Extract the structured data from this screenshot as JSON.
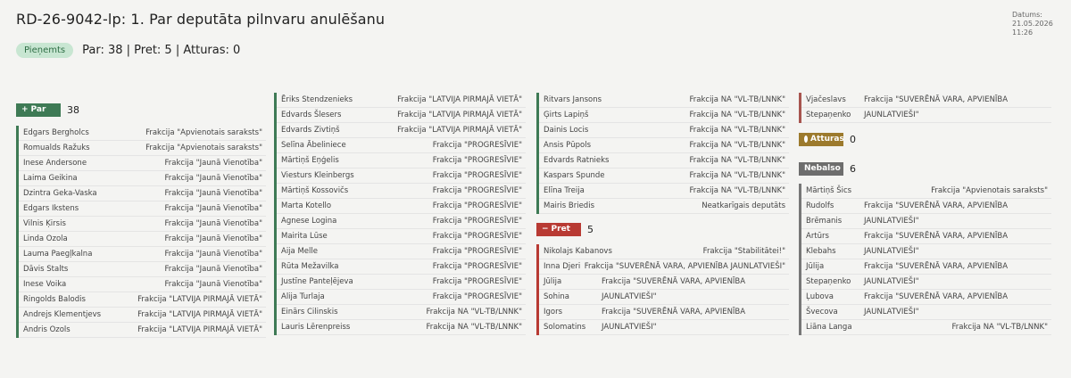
{
  "header": {
    "title": "RD-26-9042-lp: 1. Par deputāta pilnvaru anulēšanu",
    "date_label": "Datums:",
    "date": "21.05.2026",
    "time": "11:26"
  },
  "summary": {
    "status": "Pieņemts",
    "counts": "Par: 38 | Pret: 5 | Atturas: 0"
  },
  "sections": {
    "par": {
      "label": "Par",
      "count": "38"
    },
    "pret": {
      "label": "Pret",
      "count": "5"
    },
    "atturas": {
      "label": "Atturas",
      "count": "0"
    },
    "nebalso": {
      "label": "Nebalso",
      "count": "6"
    }
  },
  "col1": [
    {
      "name": "Edgars Bergholcs",
      "faction": "Frakcija \"Apvienotais saraksts\""
    },
    {
      "name": "Romualds Ražuks",
      "faction": "Frakcija \"Apvienotais saraksts\""
    },
    {
      "name": "Inese Andersone",
      "faction": "Frakcija \"Jaunā Vienotība\""
    },
    {
      "name": "Laima Geikina",
      "faction": "Frakcija \"Jaunā Vienotība\""
    },
    {
      "name": "Dzintra Geka-Vaska",
      "faction": "Frakcija \"Jaunā Vienotība\""
    },
    {
      "name": "Edgars Ikstens",
      "faction": "Frakcija \"Jaunā Vienotība\""
    },
    {
      "name": "Vilnis Ķirsis",
      "faction": "Frakcija \"Jaunā Vienotība\""
    },
    {
      "name": "Linda Ozola",
      "faction": "Frakcija \"Jaunā Vienotība\""
    },
    {
      "name": "Lauma Paegļkalna",
      "faction": "Frakcija \"Jaunā Vienotība\""
    },
    {
      "name": "Dāvis Stalts",
      "faction": "Frakcija \"Jaunā Vienotība\""
    },
    {
      "name": "Inese Voika",
      "faction": "Frakcija \"Jaunā Vienotība\""
    },
    {
      "name": "Ringolds Balodis",
      "faction": "Frakcija \"LATVIJA PIRMAJĀ VIETĀ\""
    },
    {
      "name": "Andrejs Klementjevs",
      "faction": "Frakcija \"LATVIJA PIRMAJĀ VIETĀ\""
    },
    {
      "name": "Andris Ozols",
      "faction": "Frakcija \"LATVIJA PIRMAJĀ VIETĀ\""
    }
  ],
  "col2": [
    {
      "name": "Ēriks Stendzenieks",
      "faction": "Frakcija \"LATVIJA PIRMAJĀ VIETĀ\""
    },
    {
      "name": "Edvards Šlesers",
      "faction": "Frakcija \"LATVIJA PIRMAJĀ VIETĀ\""
    },
    {
      "name": "Edvards Zivtiņš",
      "faction": "Frakcija \"LATVIJA PIRMAJĀ VIETĀ\""
    },
    {
      "name": "Selīna Ābeliniece",
      "faction": "Frakcija \"PROGRESĪVIE\""
    },
    {
      "name": "Mārtiņš Eņģelis",
      "faction": "Frakcija \"PROGRESĪVIE\""
    },
    {
      "name": "Viesturs Kleinbergs",
      "faction": "Frakcija \"PROGRESĪVIE\""
    },
    {
      "name": "Mārtiņš Kossovičs",
      "faction": "Frakcija \"PROGRESĪVIE\""
    },
    {
      "name": "Marta Kotello",
      "faction": "Frakcija \"PROGRESĪVIE\""
    },
    {
      "name": "Agnese Logina",
      "faction": "Frakcija \"PROGRESĪVIE\""
    },
    {
      "name": "Mairita Lūse",
      "faction": "Frakcija \"PROGRESĪVIE\""
    },
    {
      "name": "Aija Melle",
      "faction": "Frakcija \"PROGRESĪVIE\""
    },
    {
      "name": "Rūta Mežavilka",
      "faction": "Frakcija \"PROGRESĪVIE\""
    },
    {
      "name": "Justīne Panteļējeva",
      "faction": "Frakcija \"PROGRESĪVIE\""
    },
    {
      "name": "Alija Turlaja",
      "faction": "Frakcija \"PROGRESĪVIE\""
    },
    {
      "name": "Einārs Cilinskis",
      "faction": "Frakcija NA \"VL-TB/LNNK\""
    },
    {
      "name": "Lauris Lērenpreiss",
      "faction": "Frakcija NA \"VL-TB/LNNK\""
    }
  ],
  "col3": [
    {
      "name": "Ritvars Jansons",
      "faction": "Frakcija NA \"VL-TB/LNNK\""
    },
    {
      "name": "Ģirts Lapiņš",
      "faction": "Frakcija NA \"VL-TB/LNNK\""
    },
    {
      "name": "Dainis Locis",
      "faction": "Frakcija NA \"VL-TB/LNNK\""
    },
    {
      "name": "Ansis Pūpols",
      "faction": "Frakcija NA \"VL-TB/LNNK\""
    },
    {
      "name": "Edvards Ratnieks",
      "faction": "Frakcija NA \"VL-TB/LNNK\""
    },
    {
      "name": "Kaspars Spunde",
      "faction": "Frakcija NA \"VL-TB/LNNK\""
    },
    {
      "name": "Elīna Treija",
      "faction": "Frakcija NA \"VL-TB/LNNK\""
    },
    {
      "name": "Mairis Briedis",
      "faction": "Neatkarīgais deputāts"
    }
  ],
  "pret_rows": [
    {
      "name": "Nikolajs Kabanovs",
      "faction": "Frakcija \"Stabilitātei!\""
    },
    {
      "name": "Inna Djeri",
      "faction": "Frakcija \"SUVERĒNĀ VARA, APVIENĪBA JAUNLATVIEŠI\""
    },
    {
      "name": "Jūlija",
      "faction": "Frakcija \"SUVERĒNĀ VARA, APVIENĪBA"
    },
    {
      "name": "Sohina",
      "faction": "JAUNLATVIEŠI\""
    },
    {
      "name": "Igors",
      "faction": "Frakcija \"SUVERĒNĀ VARA, APVIENĪBA"
    },
    {
      "name": "Solomatins",
      "faction": "JAUNLATVIEŠI\""
    }
  ],
  "col4_top": [
    {
      "name": "Vjačeslavs",
      "faction": "Frakcija \"SUVERĒNĀ VARA, APVIENĪBA"
    },
    {
      "name": "Stepaņenko",
      "faction": "JAUNLATVIEŠI\""
    }
  ],
  "nebalso_rows": [
    {
      "name": "Mārtiņš Šics",
      "faction": "Frakcija \"Apvienotais saraksts\""
    },
    {
      "name": "Rudolfs",
      "faction": "Frakcija \"SUVERĒNĀ VARA, APVIENĪBA"
    },
    {
      "name": "Brēmanis",
      "faction": "JAUNLATVIEŠI\""
    },
    {
      "name": "Artūrs",
      "faction": "Frakcija \"SUVERĒNĀ VARA, APVIENĪBA"
    },
    {
      "name": "Klebahs",
      "faction": "JAUNLATVIEŠI\""
    },
    {
      "name": "Jūlija",
      "faction": "Frakcija \"SUVERĒNĀ VARA, APVIENĪBA"
    },
    {
      "name": "Stepaņenko",
      "faction": "JAUNLATVIEŠI\""
    },
    {
      "name": "Ļubova",
      "faction": "Frakcija \"SUVERĒNĀ VARA, APVIENĪBA"
    },
    {
      "name": "Švecova",
      "faction": "JAUNLATVIEŠI\""
    },
    {
      "name": "Liāna Langa",
      "faction": "Frakcija NA \"VL-TB/LNNK\""
    }
  ],
  "colors": {
    "par": "#3e7a55",
    "pret": "#b83a33",
    "atturas": "#9c7a2d",
    "nebalso": "#6d6d6d",
    "status_bg": "#c8e6d2"
  },
  "icons": {
    "par": "plus-icon",
    "pret": "minus-icon",
    "atturas": "circle-icon"
  }
}
